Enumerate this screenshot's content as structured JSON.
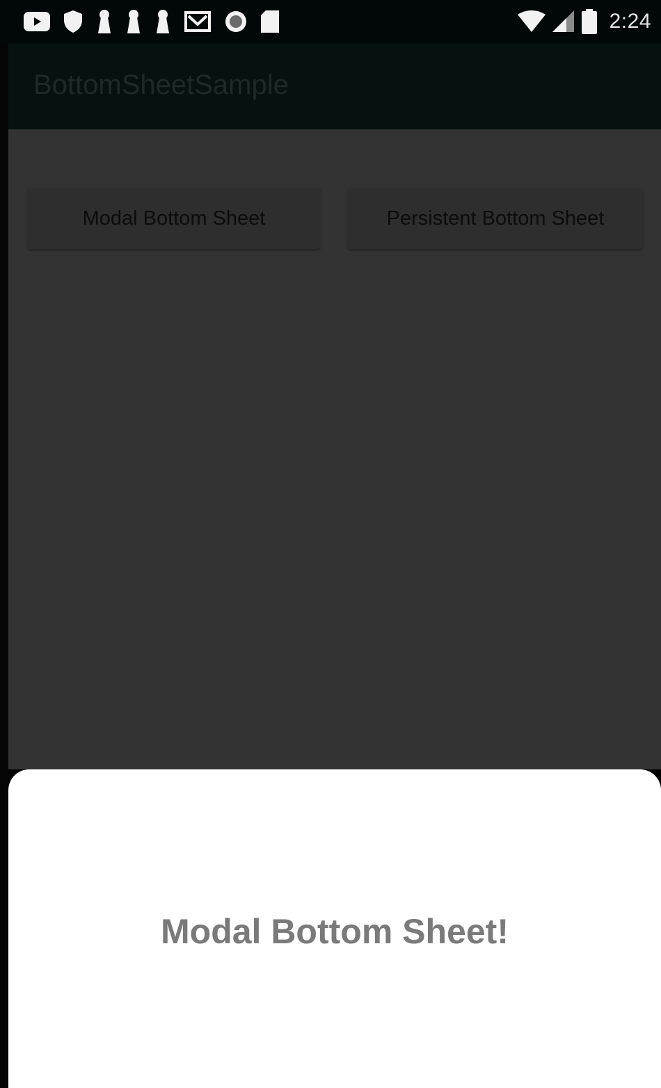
{
  "status_bar": {
    "time": "2:24",
    "left_icons": [
      "youtube-icon",
      "shield-icon",
      "keyhole-icon",
      "keyhole-icon",
      "keyhole-icon",
      "gmail-icon",
      "record-icon",
      "sd-card-icon"
    ],
    "right_icons": [
      "wifi-icon",
      "cell-signal-icon",
      "battery-icon"
    ]
  },
  "app_bar": {
    "title": "BottomSheetSample"
  },
  "main": {
    "buttons": {
      "modal_label": "Modal Bottom Sheet",
      "persistent_label": "Persistent Bottom Sheet"
    }
  },
  "bottom_sheet": {
    "text": "Modal Bottom Sheet!"
  },
  "colors": {
    "status_bar": "#020808",
    "app_bar": "#06120f",
    "scrim_background": "#333333",
    "sheet_background": "#ffffff",
    "sheet_text": "#7a7a7a"
  }
}
